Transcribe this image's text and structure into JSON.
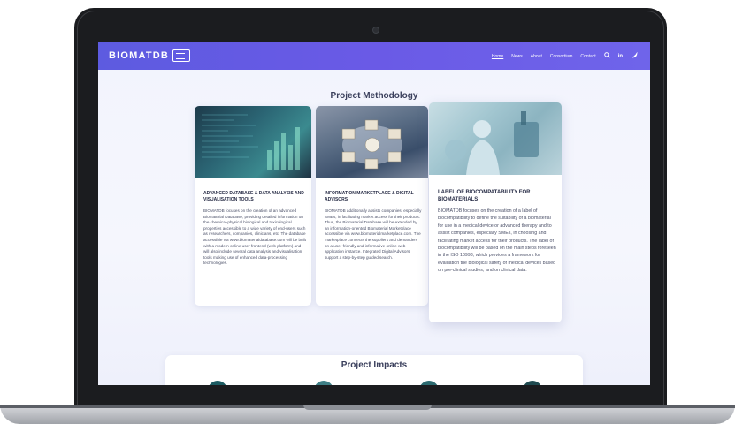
{
  "header": {
    "logo_text": "BIOMATDB",
    "nav": [
      "Home",
      "News",
      "About",
      "Consortium",
      "Contact"
    ],
    "active_item": "Home"
  },
  "methodology": {
    "title": "Project Methodology",
    "cards": [
      {
        "title": "ADVANCED DATABASE & DATA ANALYSIS AND VISUALISATION TOOLS",
        "body": "BIOMATDB focuses on the creation of an advanced Biomaterial Database, providing detailed information on the chemical-physical biological and toxicological properties accessible to a wide variety of end-users such as researchers, companies, clinicians, etc. The database accessible via www.biomaterialdatabase.com will be built with a modern online user frontend (web platform) and will also include several data analysis and visualisation tools making use of enhanced data-processing technologies."
      },
      {
        "title": "INFORMATION MARKETPLACE & DIGITAL ADVISORS",
        "body": "BIOMATDB additionally assists companies, especially SMEs, in facilitating market access for their products. Thus, the Biomaterial Database will be extended by an information-oriented Biomaterial Marketplace accessible via www.biomaterialmarketplace.com. The marketplace connects the suppliers and demanders on a user-friendly and informative online web application instance. Integrated Digital Advisors support a step-by-step guided search."
      },
      {
        "title": "LABEL OF BIOCOMPATABILITY FOR BIOMATERIALS",
        "body": "BIOMATDB focuses on the creation of a label of biocompatibility to define the suitability of a biomaterial for use in a medical device or advanced therapy and to assist companies, especially SMEs, in choosing and facilitating market access for their products. The label of biocompatibility will be based on the main steps foreseen in the ISO 10993, which provides a framework for evaluation the biological safety of medical devices based on pre-clinical studies, and on clinical data."
      }
    ]
  },
  "impacts": {
    "title": "Project Impacts"
  },
  "colors": {
    "header_start": "#5d5be0",
    "header_end": "#6f64ea",
    "background": "#f2f4fd"
  },
  "icons": [
    "search-icon",
    "linkedin-icon",
    "twitter-icon"
  ]
}
